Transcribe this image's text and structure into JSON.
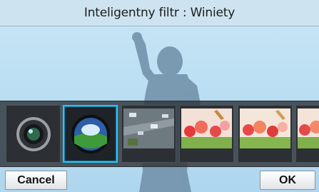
{
  "title": "Inteligentny filtr : Winiety",
  "filters": [
    {
      "name": "lens-filter",
      "selected": false
    },
    {
      "name": "globe-filter",
      "selected": true
    },
    {
      "name": "city-filter",
      "selected": false
    },
    {
      "name": "flowers-filter-1",
      "selected": false
    },
    {
      "name": "flowers-filter-2",
      "selected": false
    },
    {
      "name": "flowers-filter-3",
      "selected": false
    }
  ],
  "buttons": {
    "cancel": "Cancel",
    "ok": "OK"
  },
  "colors": {
    "selection": "#2bc3f3",
    "sky": "#bfe0f3",
    "strip": "#30343a"
  }
}
